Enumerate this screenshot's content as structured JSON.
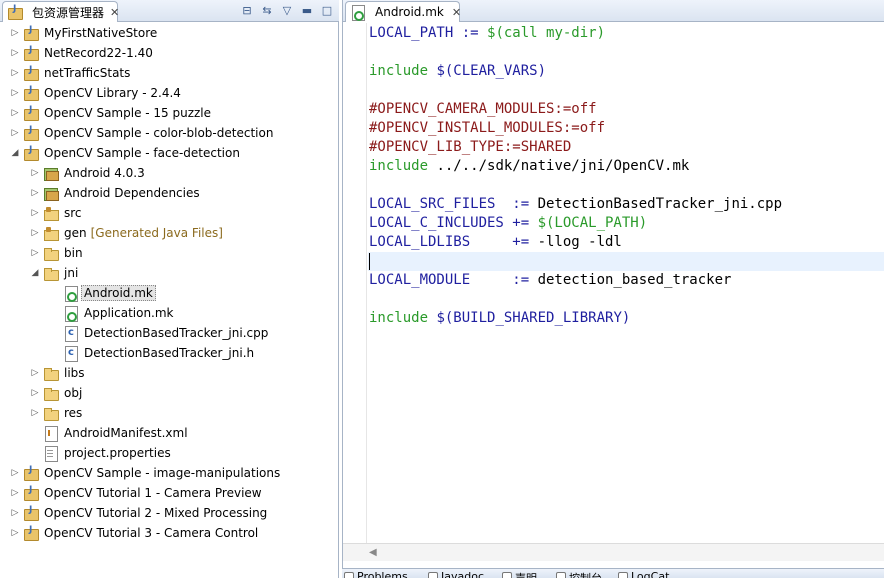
{
  "explorer": {
    "tab_label": "包资源管理器",
    "tab_close": "✕",
    "tools": [
      {
        "name": "collapse-all-icon",
        "glyph": "⊟"
      },
      {
        "name": "link-with-editor-icon",
        "glyph": "⇆"
      },
      {
        "name": "view-menu-icon",
        "glyph": "▽"
      },
      {
        "name": "minimize-icon",
        "glyph": "▬"
      },
      {
        "name": "maximize-icon",
        "glyph": "□"
      }
    ],
    "tree": [
      {
        "label": "MyFirstNativeStore",
        "depth": 0,
        "expanded": false,
        "icon": "project"
      },
      {
        "label": "NetRecord22-1.40",
        "depth": 0,
        "expanded": false,
        "icon": "project"
      },
      {
        "label": "netTrafficStats",
        "depth": 0,
        "expanded": false,
        "icon": "project"
      },
      {
        "label": "OpenCV Library - 2.4.4",
        "depth": 0,
        "expanded": false,
        "icon": "project"
      },
      {
        "label": "OpenCV Sample - 15 puzzle",
        "depth": 0,
        "expanded": false,
        "icon": "project"
      },
      {
        "label": "OpenCV Sample - color-blob-detection",
        "depth": 0,
        "expanded": false,
        "icon": "project"
      },
      {
        "label": "OpenCV Sample - face-detection",
        "depth": 0,
        "expanded": true,
        "icon": "project"
      },
      {
        "label": "Android 4.0.3",
        "depth": 1,
        "expanded": false,
        "icon": "lib"
      },
      {
        "label": "Android Dependencies",
        "depth": 1,
        "expanded": false,
        "icon": "lib"
      },
      {
        "label": "src",
        "depth": 1,
        "expanded": false,
        "icon": "src"
      },
      {
        "label": "gen",
        "depth": 1,
        "expanded": false,
        "icon": "src",
        "decor": "[Generated Java Files]"
      },
      {
        "label": "bin",
        "depth": 1,
        "expanded": false,
        "icon": "folder"
      },
      {
        "label": "jni",
        "depth": 1,
        "expanded": true,
        "icon": "folder"
      },
      {
        "label": "Android.mk",
        "depth": 2,
        "leaf": true,
        "icon": "mk",
        "selected": true
      },
      {
        "label": "Application.mk",
        "depth": 2,
        "leaf": true,
        "icon": "mk"
      },
      {
        "label": "DetectionBasedTracker_jni.cpp",
        "depth": 2,
        "leaf": true,
        "icon": "c"
      },
      {
        "label": "DetectionBasedTracker_jni.h",
        "depth": 2,
        "leaf": true,
        "icon": "c"
      },
      {
        "label": "libs",
        "depth": 1,
        "expanded": false,
        "icon": "folder"
      },
      {
        "label": "obj",
        "depth": 1,
        "expanded": false,
        "icon": "folder"
      },
      {
        "label": "res",
        "depth": 1,
        "expanded": false,
        "icon": "folder"
      },
      {
        "label": "AndroidManifest.xml",
        "depth": 1,
        "leaf": true,
        "icon": "xml"
      },
      {
        "label": "project.properties",
        "depth": 1,
        "leaf": true,
        "icon": "file"
      },
      {
        "label": "OpenCV Sample - image-manipulations",
        "depth": 0,
        "expanded": false,
        "icon": "project"
      },
      {
        "label": "OpenCV Tutorial 1 - Camera Preview",
        "depth": 0,
        "expanded": false,
        "icon": "project"
      },
      {
        "label": "OpenCV Tutorial 2 - Mixed Processing",
        "depth": 0,
        "expanded": false,
        "icon": "project"
      },
      {
        "label": "OpenCV Tutorial 3 - Camera Control",
        "depth": 0,
        "expanded": false,
        "icon": "project"
      }
    ]
  },
  "editor": {
    "tab_label": "Android.mk",
    "tab_close": "✕",
    "current_line": 12,
    "lines": [
      [
        {
          "t": "var",
          "s": "LOCAL_PATH := "
        },
        {
          "t": "kw",
          "s": "$(call my-dir)"
        }
      ],
      [],
      [
        {
          "t": "kw",
          "s": "include "
        },
        {
          "t": "var",
          "s": "$(CLEAR_VARS)"
        }
      ],
      [],
      [
        {
          "t": "comment",
          "s": "#OPENCV_CAMERA_MODULES:=off"
        }
      ],
      [
        {
          "t": "comment",
          "s": "#OPENCV_INSTALL_MODULES:=off"
        }
      ],
      [
        {
          "t": "comment",
          "s": "#OPENCV_LIB_TYPE:=SHARED"
        }
      ],
      [
        {
          "t": "kw",
          "s": "include "
        },
        {
          "t": "plain",
          "s": "../../sdk/native/jni/OpenCV.mk"
        }
      ],
      [],
      [
        {
          "t": "var",
          "s": "LOCAL_SRC_FILES  := "
        },
        {
          "t": "plain",
          "s": "DetectionBasedTracker_jni.cpp"
        }
      ],
      [
        {
          "t": "var",
          "s": "LOCAL_C_INCLUDES += "
        },
        {
          "t": "kw",
          "s": "$(LOCAL_PATH)"
        }
      ],
      [
        {
          "t": "var",
          "s": "LOCAL_LDLIBS     += "
        },
        {
          "t": "plain",
          "s": "-llog -ldl"
        }
      ],
      [],
      [
        {
          "t": "var",
          "s": "LOCAL_MODULE     := "
        },
        {
          "t": "plain",
          "s": "detection_based_tracker"
        }
      ],
      [],
      [
        {
          "t": "kw",
          "s": "include "
        },
        {
          "t": "var",
          "s": "$(BUILD_SHARED_LIBRARY)"
        }
      ]
    ],
    "scroll_arrow": "◀"
  },
  "bottom_tabs": [
    {
      "label": "Problems"
    },
    {
      "label": "Javadoc"
    },
    {
      "label": "声明"
    },
    {
      "label": "控制台"
    },
    {
      "label": "LogCat"
    }
  ]
}
